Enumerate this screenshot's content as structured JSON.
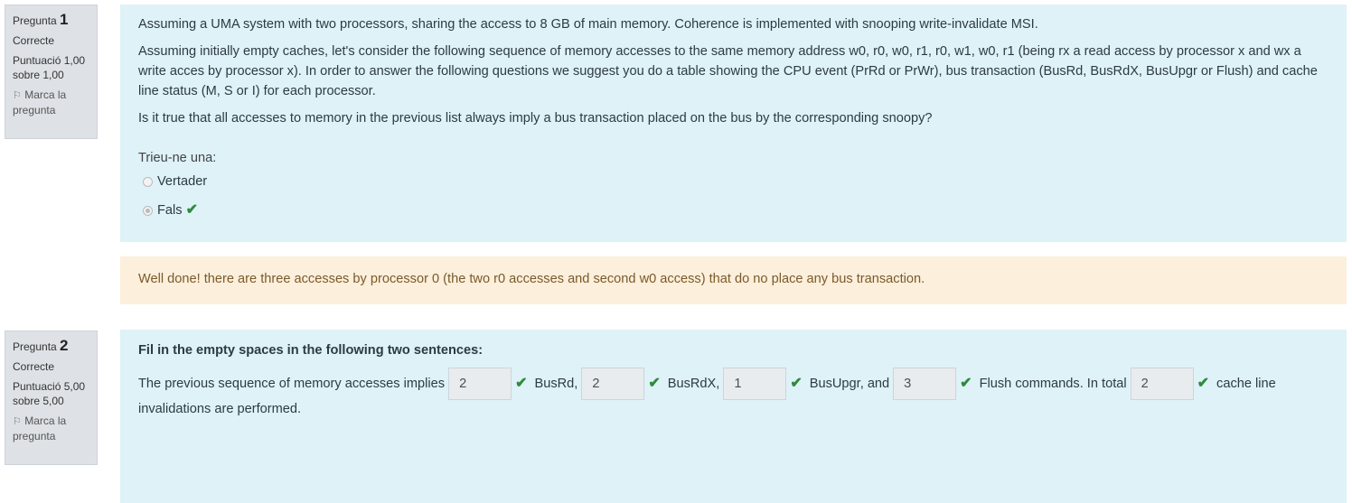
{
  "q1": {
    "info": {
      "label": "Pregunta",
      "number": "1",
      "state": "Correcte",
      "grade_line1": "Puntuació 1,00",
      "grade_line2": "sobre 1,00",
      "flag_line1": "Marca la",
      "flag_line2": "pregunta"
    },
    "text1": "Assuming a UMA system with two processors, sharing the access to 8 GB of main memory. Coherence is implemented with snooping write-invalidate MSI.",
    "text2": "Assuming initially empty caches, let's consider the following sequence of memory accesses to the same memory address w0, r0, w0, r1, r0, w1, w0, r1 (being rx a read access by processor x and wx a write acces by processor x). In order to answer the following questions we suggest you do a table showing the CPU event (PrRd or PrWr), bus transaction (BusRd, BusRdX, BusUpgr or Flush) and cache line status (M, S or I) for each processor.",
    "text3": "Is it true that all accesses to memory in the previous list always imply a bus transaction placed on the bus by the corresponding snoopy?",
    "answer_prompt": "Trieu-ne una:",
    "options": [
      {
        "label": "Vertader",
        "selected": false
      },
      {
        "label": "Fals",
        "selected": true
      }
    ],
    "feedback": "Well done! there are three accesses by processor 0 (the two r0 accesses and second w0 access) that do no place any bus transaction."
  },
  "q2": {
    "info": {
      "label": "Pregunta",
      "number": "2",
      "state": "Correcte",
      "grade_line1": "Puntuació 5,00",
      "grade_line2": "sobre 5,00",
      "flag_line1": "Marca la",
      "flag_line2": "pregunta"
    },
    "heading": "Fil in the empty spaces in the following two sentences:",
    "sentence_start": "The previous sequence of memory accesses implies",
    "blanks": [
      {
        "value": "2",
        "after": "BusRd,"
      },
      {
        "value": "2",
        "after": "BusRdX,"
      },
      {
        "value": "1",
        "after": "BusUpgr, and"
      },
      {
        "value": "3",
        "after": "Flush commands. In total"
      },
      {
        "value": "2",
        "after": "cache line"
      }
    ],
    "sentence_end": "invalidations are performed."
  },
  "colors": {
    "question_bg": "#def2f8",
    "feedback_bg": "#fcefdc",
    "info_bg": "#dee2e6",
    "correct_green": "#2e8b3a"
  }
}
